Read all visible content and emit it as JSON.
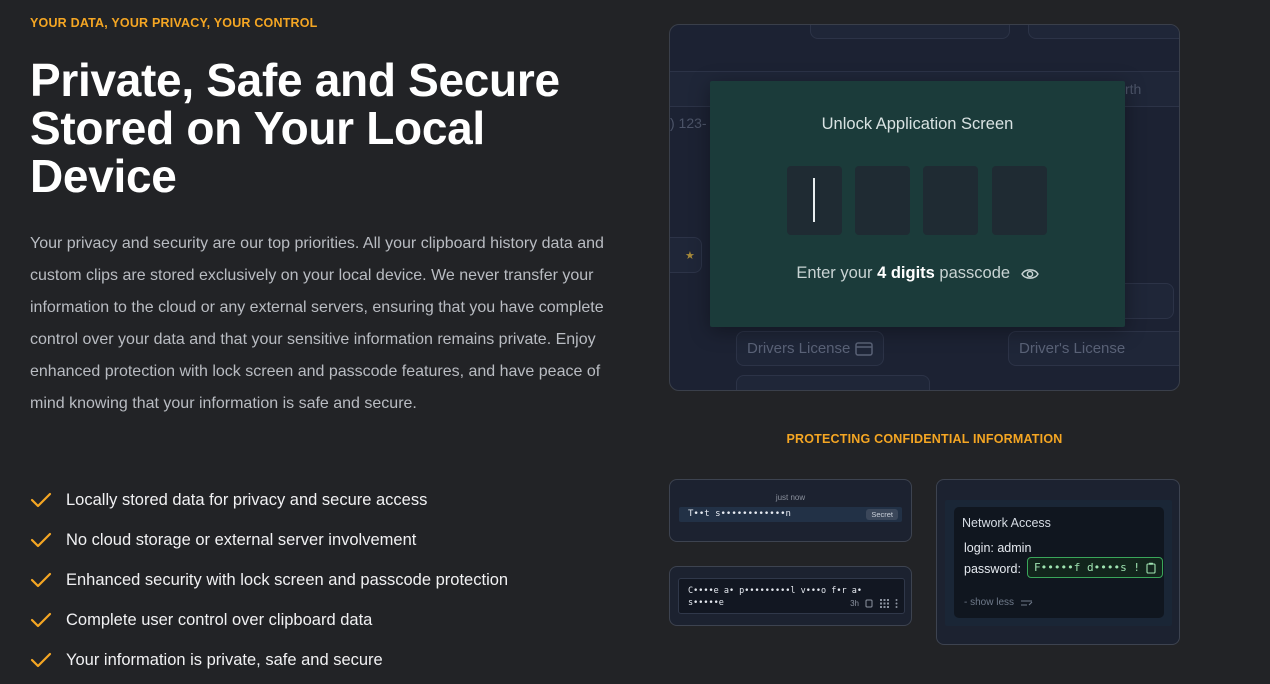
{
  "hero": {
    "eyebrow": "YOUR DATA, YOUR PRIVACY, YOUR CONTROL",
    "headline": "Private, Safe and Secure Stored on Your Local Device",
    "body": "Your privacy and security are our top priorities. All your clipboard history data and custom clips are stored exclusively on your local device. We never transfer your information to the cloud or any external servers, ensuring that you have complete control over your data and that your sensitive information remains private. Enjoy enhanced protection with lock screen and passcode features, and have peace of mind knowing that your information is safe and secure."
  },
  "features": [
    "Locally stored data for privacy and secure access",
    "No cloud storage or external server involvement",
    "Enhanced security with lock screen and passcode protection",
    "Complete user control over clipboard data",
    "Your information is private, safe and secure"
  ],
  "preview": {
    "background": {
      "phone_fragment": ") 123-",
      "earth_fragment": "rth",
      "chip_left": "Drivers License",
      "chip_right": "Driver's License"
    },
    "unlock": {
      "title": "Unlock Application Screen",
      "hint_prefix": "Enter your ",
      "hint_bold": "4 digits",
      "hint_suffix": " passcode"
    }
  },
  "subhead": "PROTECTING CONFIDENTIAL INFORMATION",
  "cards": {
    "secret": {
      "time": "just now",
      "masked_text": "T••t s••••••••••••n",
      "badge": "Secret"
    },
    "clip": {
      "masked_text": "C••••e a• p•••••••••l v•••o f•r a• s•••••e",
      "age": "3h"
    },
    "network": {
      "title": "Network Access",
      "login": "login: admin",
      "password_label": "password:",
      "password_value": "F•••••f d••••s !",
      "show_less": "- show less"
    }
  },
  "colors": {
    "accent": "#f5a623",
    "panel": "#1b3b3a",
    "success": "#3aa65a"
  }
}
